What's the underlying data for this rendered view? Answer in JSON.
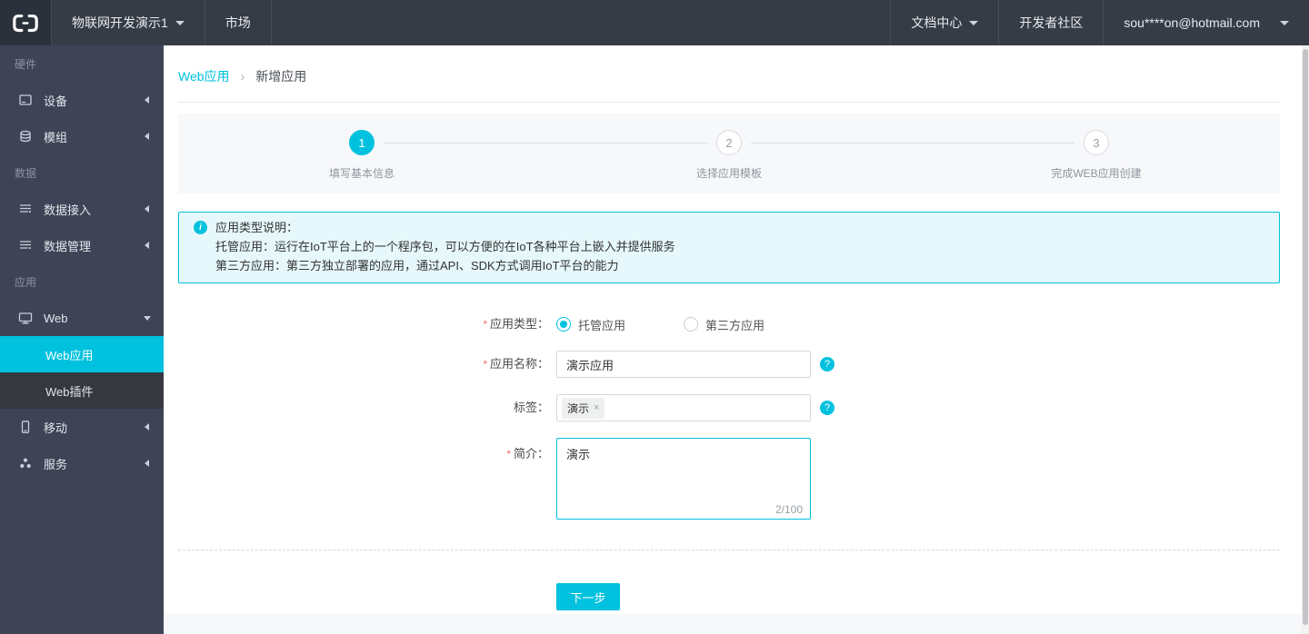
{
  "topbar": {
    "project": "物联网开发演示1",
    "market": "市场",
    "docs": "文档中心",
    "community": "开发者社区",
    "account": "sou****on@hotmail.com"
  },
  "sidebar": {
    "sections": [
      {
        "header": "硬件",
        "items": [
          {
            "label": "设备",
            "icon": "device-icon"
          },
          {
            "label": "模组",
            "icon": "module-icon"
          }
        ]
      },
      {
        "header": "数据",
        "items": [
          {
            "label": "数据接入",
            "icon": "data-access-icon"
          },
          {
            "label": "数据管理",
            "icon": "data-manage-icon"
          }
        ]
      },
      {
        "header": "应用",
        "items": [
          {
            "label": "Web",
            "icon": "web-icon",
            "expanded": true,
            "children": [
              {
                "label": "Web应用",
                "active": true
              },
              {
                "label": "Web插件",
                "active": false
              }
            ]
          },
          {
            "label": "移动",
            "icon": "mobile-icon"
          },
          {
            "label": "服务",
            "icon": "service-icon"
          }
        ]
      }
    ]
  },
  "breadcrumb": {
    "parent": "Web应用",
    "separator": "›",
    "current": "新增应用"
  },
  "stepper": {
    "steps": [
      {
        "num": "1",
        "label": "填写基本信息",
        "active": true
      },
      {
        "num": "2",
        "label": "选择应用模板",
        "active": false
      },
      {
        "num": "3",
        "label": "完成WEB应用创建",
        "active": false
      }
    ]
  },
  "info_box": {
    "icon": "info-icon",
    "title": "应用类型说明：",
    "line1": "托管应用：运行在IoT平台上的一个程序包，可以方便的在IoT各种平台上嵌入并提供服务",
    "line2": "第三方应用：第三方独立部署的应用，通过API、SDK方式调用IoT平台的能力"
  },
  "form": {
    "required_mark": "*",
    "app_type": {
      "label": "应用类型：",
      "options": [
        {
          "label": "托管应用",
          "selected": true
        },
        {
          "label": "第三方应用",
          "selected": false
        }
      ]
    },
    "app_name": {
      "label": "应用名称：",
      "value": "演示应用",
      "help_icon": "?"
    },
    "tags": {
      "label": "标签：",
      "chip": "演示",
      "chip_close": "×",
      "help_icon": "?"
    },
    "intro": {
      "label": "简介：",
      "value": "演示",
      "counter": "2/100"
    },
    "next_button": "下一步"
  },
  "colors": {
    "accent": "#00c1de",
    "topbar_bg": "#363c46",
    "sidebar_bg": "#3e4456",
    "submenu_bg": "#35383f",
    "stepper_bg": "#f7f8fa",
    "info_bg": "#e6f8fc",
    "required": "#f56c6c"
  }
}
